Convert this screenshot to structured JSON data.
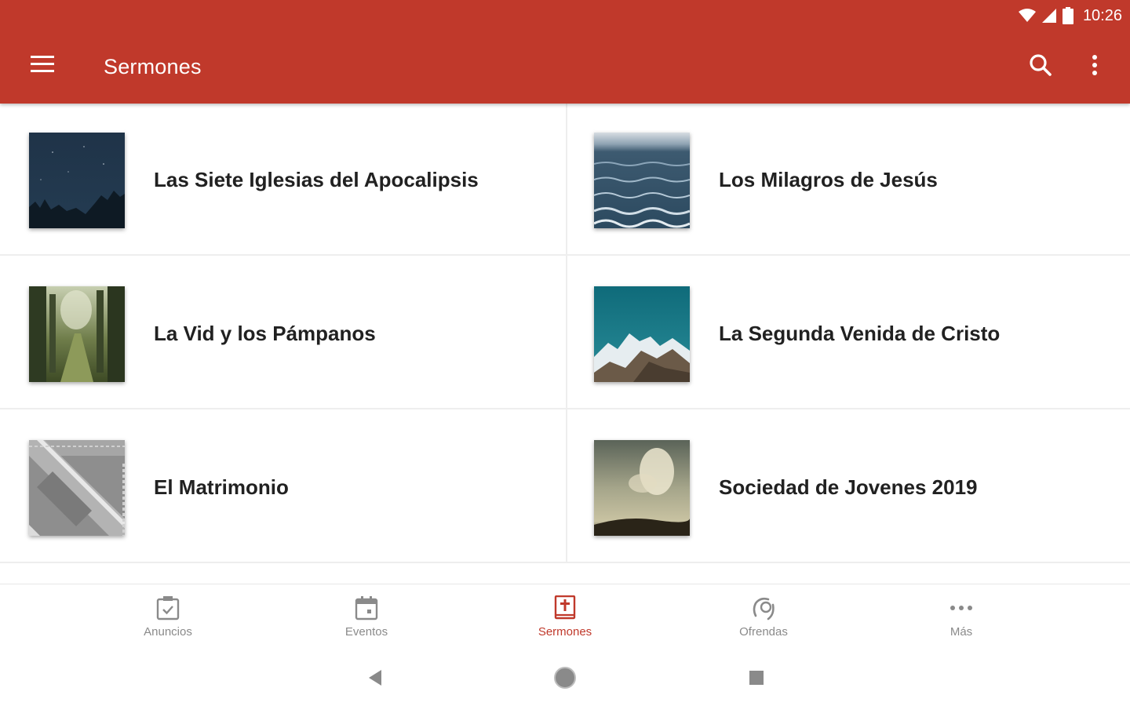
{
  "status_bar": {
    "time": "10:26"
  },
  "app_bar": {
    "title": "Sermones",
    "menu_icon": "hamburger-menu-icon",
    "search_icon": "search-icon",
    "more_icon": "more-vert-icon"
  },
  "colors": {
    "primary": "#c0392b",
    "active_nav": "#c0392b",
    "inactive_nav": "#8a8a8a"
  },
  "sermons": [
    {
      "title": "Las Siete Iglesias del Apocalipsis",
      "thumbnail": "night-sky-trees"
    },
    {
      "title": "Los Milagros de Jesús",
      "thumbnail": "sea-waves"
    },
    {
      "title": "La Vid y los Pámpanos",
      "thumbnail": "forest-path"
    },
    {
      "title": "La Segunda Venida de Cristo",
      "thumbnail": "snowy-mountains"
    },
    {
      "title": "El Matrimonio",
      "thumbnail": "grey-steps"
    },
    {
      "title": "Sociedad de Jovenes 2019",
      "thumbnail": "cloudy-sky-field"
    }
  ],
  "bottom_nav": [
    {
      "label": "Anuncios",
      "icon": "announcement-check-icon",
      "active": false
    },
    {
      "label": "Eventos",
      "icon": "calendar-icon",
      "active": false
    },
    {
      "label": "Sermones",
      "icon": "bible-icon",
      "active": true
    },
    {
      "label": "Ofrendas",
      "icon": "offering-hand-icon",
      "active": false
    },
    {
      "label": "Más",
      "icon": "more-horiz-icon",
      "active": false
    }
  ],
  "system_nav": {
    "back_icon": "back-triangle-icon",
    "home_icon": "home-circle-icon",
    "recents_icon": "recents-square-icon"
  }
}
